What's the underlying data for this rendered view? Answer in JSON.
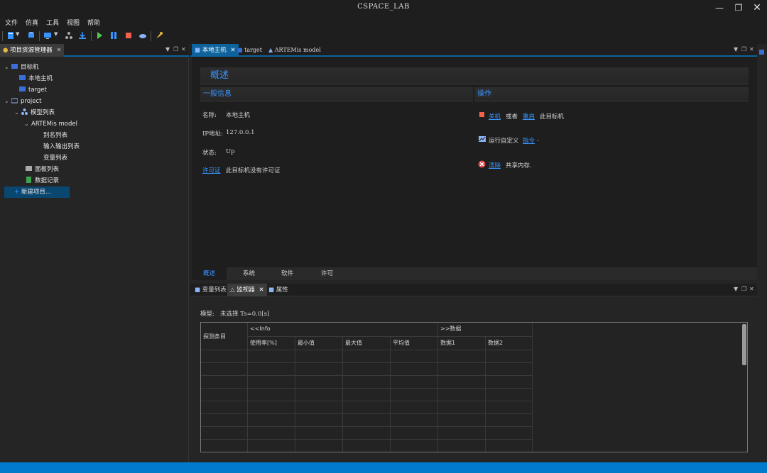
{
  "window": {
    "title": "CSPACE_LAB"
  },
  "menu": [
    "文件",
    "仿真",
    "工具",
    "视图",
    "帮助"
  ],
  "left_panel": {
    "tab_label": "项目资源管理器",
    "tree": [
      {
        "label": "目标机",
        "level": 0,
        "expander": "⌄",
        "icon": "target-machine-icon"
      },
      {
        "label": "本地主机",
        "level": 1,
        "expander": "",
        "icon": "host-icon"
      },
      {
        "label": "target",
        "level": 1,
        "expander": "",
        "icon": "host-icon"
      },
      {
        "label": "project",
        "level": 0,
        "expander": "⌄",
        "icon": "folder-icon"
      },
      {
        "label": "模型列表",
        "level": 1,
        "expander": "⌄",
        "icon": "model-list-icon"
      },
      {
        "label": "ARTEMis model",
        "level": 2,
        "expander": "⌄",
        "icon": ""
      },
      {
        "label": "别名列表",
        "level": 3,
        "expander": "",
        "icon": ""
      },
      {
        "label": "输入输出列表",
        "level": 3,
        "expander": "",
        "icon": ""
      },
      {
        "label": "变量列表",
        "level": 3,
        "expander": "",
        "icon": ""
      },
      {
        "label": "面板列表",
        "level": 1,
        "expander": "",
        "icon": "panel-icon"
      },
      {
        "label": "数据记录",
        "level": 1,
        "expander": "",
        "icon": "data-record-icon"
      },
      {
        "label": "新建项目...",
        "level": 0,
        "expander": "",
        "icon": "add-icon",
        "selected": true
      }
    ]
  },
  "editor": {
    "tabs": [
      "本地主机",
      "target",
      "ARTEMis model"
    ],
    "overview_title": "概述",
    "general": {
      "header": "一般信息",
      "name_label": "名称:",
      "name_value": "本地主机",
      "ip_label": "IP地址:",
      "ip_value": "127.0.0.1",
      "status_label": "状态:",
      "status_value": "Up",
      "license_link": "许可证",
      "license_text": "此目标机没有许可证"
    },
    "operations": {
      "header": "操作",
      "shutdown_link": "关机",
      "or_text": "或者",
      "restart_link": "重启",
      "this_target_text": "此目标机",
      "run_custom_text": "运行自定义",
      "command_link": "指令",
      "period": ".",
      "clear_link": "清除",
      "shared_memory_text": "共享内存."
    },
    "bottom_tabs": [
      "概述",
      "系统",
      "软件",
      "许可"
    ]
  },
  "lower_panel": {
    "tabs": [
      "变量列表",
      "监视器",
      "属性"
    ],
    "model_label": "模型:",
    "model_value": "未选择 Ts=0.0[s]",
    "grid": {
      "probe_header": "探测条目",
      "info_header": "<<Info",
      "data_header": ">>数据",
      "columns": [
        "使用率[%]",
        "最小值",
        "最大值",
        "平均值",
        "数据1",
        "数据2"
      ]
    }
  },
  "colors": {
    "accent": "#0e639c",
    "link": "#3794ff",
    "statusbar": "#007acc"
  }
}
